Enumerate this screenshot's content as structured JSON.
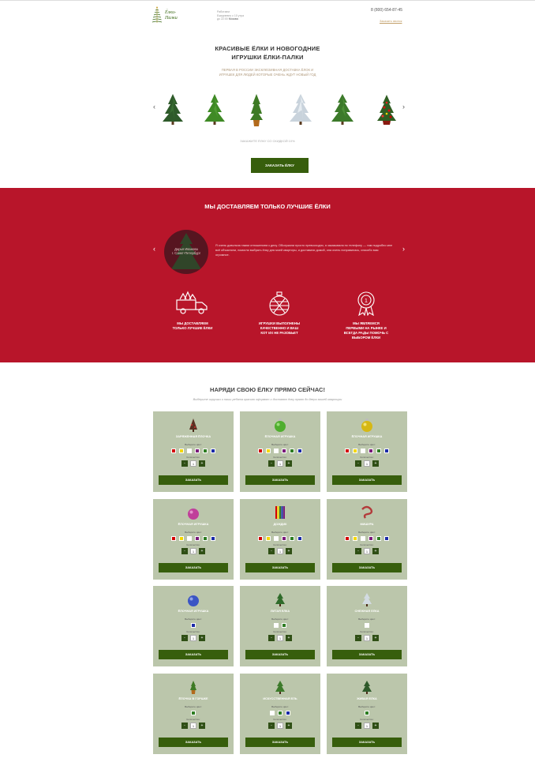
{
  "header": {
    "logo_line1": "Ёлки-",
    "logo_line2": "Палки",
    "info_line1": "Работаем",
    "info_line2": "Ежедневно с 10 утра",
    "info_line3": "до 22:00",
    "info_bold": "Москва",
    "phone": "8 (800) 654-87-45",
    "call_link": "Заказать звонок"
  },
  "hero": {
    "title_line1": "КРАСИВЫЕ ЁЛКИ И НОВОГОДНИЕ",
    "title_line2": "ИГРУШКИ ЁЛКИ-ПАЛКИ",
    "subtitle_line1": "ПЕРВАЯ В РОССИИ ЭКСКЛЮЗИВНАЯ ДОСТАВКА ЁЛОК И",
    "subtitle_line2": "ИГРУШЕК ДЛЯ ЛЮДЕЙ КОТОРЫЕ ОЧЕНЬ ЖДУТ НОВЫЙ ГОД",
    "caption": "ЗАКАЖИТЕ ЁЛКУ СО СКИДКОЙ 10%",
    "order_button": "ЗАКАЗАТЬ ЁЛКУ",
    "prev_arrow": "‹",
    "next_arrow": "›"
  },
  "delivery": {
    "title": "МЫ ДОСТАВЛЯЕМ ТОЛЬКО ЛУЧШИЕ ЁЛКИ",
    "reviewer_line1": "Дарья Иванова",
    "reviewer_line2": "г. Санкт-Петербург",
    "review_text": "Я очень довольна таким отношением к делу. Обслужили просто превосходно, я заказывала по телефону — там подробно мне всё объяснили, помогли выбрать ёлку для моей квартиры, и доставили домой, она очень понравилась, спасибо вам огромное.",
    "prev_arrow": "‹",
    "next_arrow": "›",
    "features": [
      {
        "icon": "delivery-truck-icon",
        "line1": "МЫ ДОСТАВЛЯЕМ",
        "line2": "ТОЛЬКО ЛУЧШИЕ ЁЛКИ",
        "line3": ""
      },
      {
        "icon": "ornament-ball-icon",
        "line1": "ИГРУШКИ ВЫПОЛНЕНЫ",
        "line2": "КАЧЕСТВЕННО И ВАШ",
        "line3": "КОТ ИХ НЕ РАЗОБЬЕТ"
      },
      {
        "icon": "award-badge-icon",
        "line1": "МЫ ЯВЛЯЕМСЯ",
        "line2": "ПЕРВЫМИ НА РЫНКЕ И",
        "line3": "ВСЕГДА РАДЫ ПОМОЧЬ С ВЫБОРОМ ЁЛКИ"
      }
    ]
  },
  "shop": {
    "title": "НАРЯДИ СВОЮ ЁЛКУ ПРЯМО СЕЙЧАС!",
    "subtitle": "Выберите игрушки и наши ребята красиво оформят и доставят ёлку прямо до двери вашей квартиры",
    "color_label": "Выберите цвет:",
    "qty_label": "Количество:",
    "qty_value": "1",
    "minus": "-",
    "plus": "+",
    "order_label": "ЗАКАЗАТЬ",
    "products": [
      {
        "name": "ЗАРЯЖЕННАЯ ЁЛОЧКА",
        "icon": "cone-tree-icon",
        "colors": [
          "#d40000",
          "#f5d800",
          "#ffffff",
          "#7a1a7a",
          "#2e7d22",
          "#1a2aa8"
        ]
      },
      {
        "name": "ЁЛОЧНАЯ ИГРУШКА",
        "icon": "green-ball-icon",
        "colors": [
          "#d40000",
          "#f5d800",
          "#ffffff",
          "#7a1a7a",
          "#2e7d22",
          "#1a2aa8"
        ]
      },
      {
        "name": "ЁЛОЧНАЯ ИГРУШКА",
        "icon": "gold-ball-icon",
        "colors": [
          "#d40000",
          "#f5d800",
          "#ffffff",
          "#7a1a7a",
          "#2e7d22",
          "#1a2aa8"
        ]
      },
      {
        "name": "ЁЛОЧНАЯ ИГРУШКА",
        "icon": "pink-ball-icon",
        "colors": [
          "#d40000",
          "#f5d800",
          "#ffffff",
          "#7a1a7a",
          "#2e7d22",
          "#1a2aa8"
        ]
      },
      {
        "name": "ДОЖДИК",
        "icon": "tinsel-icon",
        "colors": [
          "#d40000",
          "#f5d800",
          "#ffffff",
          "#7a1a7a",
          "#2e7d22",
          "#1a2aa8"
        ]
      },
      {
        "name": "МИШУРА",
        "icon": "garland-icon",
        "colors": [
          "#d40000",
          "#f5d800",
          "#ffffff",
          "#7a1a7a",
          "#2e7d22",
          "#1a2aa8"
        ]
      },
      {
        "name": "ЁЛОЧНАЯ ИГРУШКА",
        "icon": "blue-ball-icon",
        "colors": [
          "#1a2aa8"
        ]
      },
      {
        "name": "ЛИТАЯ ЕЛКА",
        "icon": "cast-tree-icon",
        "colors": [
          "#ffffff",
          "#2e7d22"
        ]
      },
      {
        "name": "СНЕЖНАЯ ЕЛКА",
        "icon": "snow-tree-icon",
        "colors": [
          "#ffffff"
        ]
      },
      {
        "name": "ЁЛОЧКА В ГОРШКЕ",
        "icon": "potted-tree-icon",
        "colors": [
          "#2e7d22"
        ]
      },
      {
        "name": "ИСКУССТВЕННАЯ ЕЛЬ",
        "icon": "artificial-fir-icon",
        "colors": [
          "#ffffff",
          "#2e7d22",
          "#1a2aa8"
        ]
      },
      {
        "name": "ЖИВАЯ ЕЛКА",
        "icon": "live-fir-icon",
        "colors": [
          "#2e7d22"
        ]
      }
    ]
  },
  "colors": {
    "accent_green": "#375e0c",
    "red_section": "#b8152a",
    "card_bg": "#bbc6ab"
  }
}
